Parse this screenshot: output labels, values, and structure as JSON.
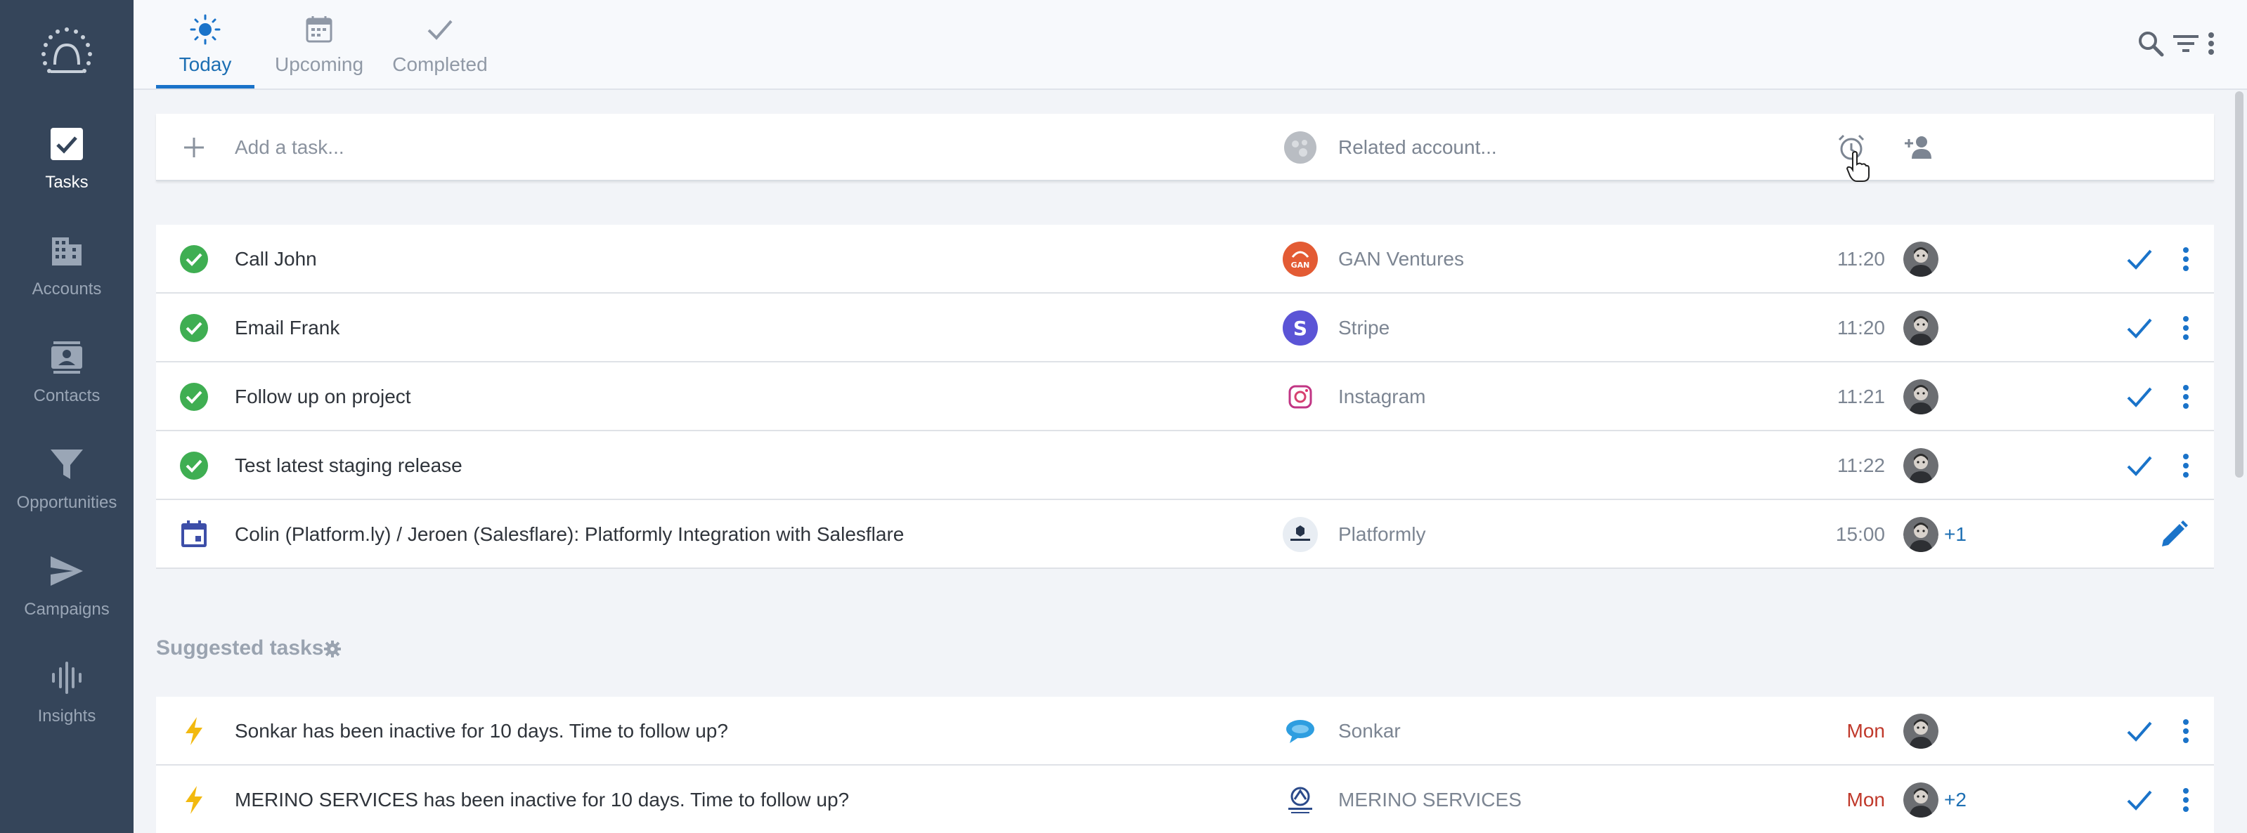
{
  "sidebar": {
    "items": [
      {
        "label": "Tasks",
        "icon": "checkbox-icon",
        "active": true
      },
      {
        "label": "Accounts",
        "icon": "building-icon"
      },
      {
        "label": "Contacts",
        "icon": "contact-card-icon"
      },
      {
        "label": "Opportunities",
        "icon": "funnel-icon"
      },
      {
        "label": "Campaigns",
        "icon": "send-icon"
      },
      {
        "label": "Insights",
        "icon": "waveform-icon"
      }
    ]
  },
  "tabs": [
    {
      "label": "Today",
      "icon": "sun-icon",
      "active": true
    },
    {
      "label": "Upcoming",
      "icon": "calendar-icon"
    },
    {
      "label": "Completed",
      "icon": "check-icon"
    }
  ],
  "add_task": {
    "placeholder": "Add a task...",
    "account_placeholder": "Related account..."
  },
  "tasks": [
    {
      "title": "Call John",
      "account": "GAN Ventures",
      "time": "11:20"
    },
    {
      "title": "Email Frank",
      "account": "Stripe",
      "time": "11:20"
    },
    {
      "title": "Follow up on project",
      "account": "Instagram",
      "time": "11:21"
    },
    {
      "title": "Test latest staging release",
      "account": "",
      "time": "11:22"
    },
    {
      "title": "Colin (Platform.ly) / Jeroen (Salesflare): Platformly Integration with Salesflare",
      "account": "Platformly",
      "time": "15:00",
      "extra": "+1"
    }
  ],
  "suggested": {
    "title": "Suggested tasks",
    "items": [
      {
        "title": "Sonkar has been inactive for 10 days. Time to follow up?",
        "account": "Sonkar",
        "time": "Mon"
      },
      {
        "title": "MERINO SERVICES has been inactive for 10 days. Time to follow up?",
        "account": "MERINO SERVICES",
        "time": "Mon",
        "extra": "+2"
      }
    ]
  },
  "colors": {
    "sidebar_bg": "#35455a",
    "accent": "#1a73c9",
    "done_green": "#3fae52",
    "suggest_yellow": "#f2b90f",
    "overdue_red": "#c0392b"
  }
}
